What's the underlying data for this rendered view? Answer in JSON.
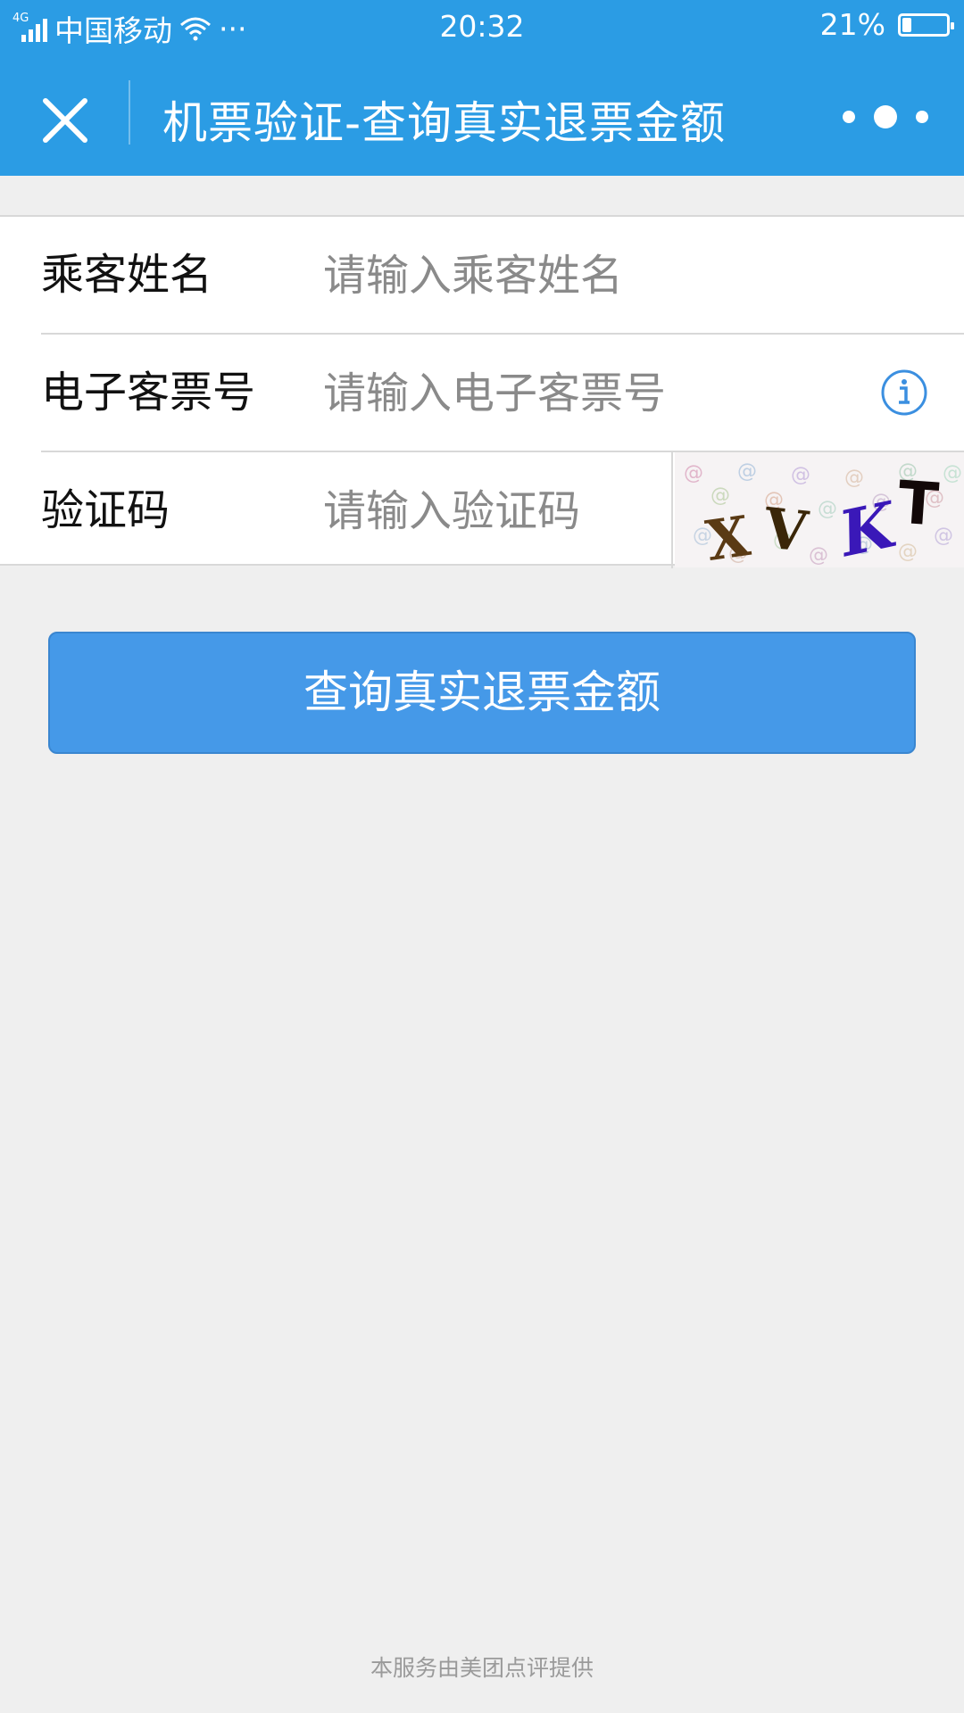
{
  "status_bar": {
    "network": "4G",
    "carrier": "中国移动",
    "extra": "···",
    "time": "20:32",
    "battery_percent": "21%",
    "battery_level": 0.21
  },
  "navbar": {
    "title": "机票验证-查询真实退票金额",
    "close_icon": "close-icon",
    "more_icon": "more-dots-icon"
  },
  "form": {
    "passenger_name": {
      "label": "乘客姓名",
      "placeholder": "请输入乘客姓名"
    },
    "ticket_number": {
      "label": "电子客票号",
      "placeholder": "请输入电子客票号",
      "icon": "info-icon"
    },
    "captcha": {
      "label": "验证码",
      "placeholder": "请输入验证码",
      "image_text": "XVKT"
    }
  },
  "submit_label": "查询真实退票金额",
  "footer_text": "本服务由美团点评提供",
  "colors": {
    "header_blue": "#2b9ce4",
    "button_blue": "#4599e8",
    "info_blue": "#3b8fe0",
    "background": "#efefef"
  }
}
